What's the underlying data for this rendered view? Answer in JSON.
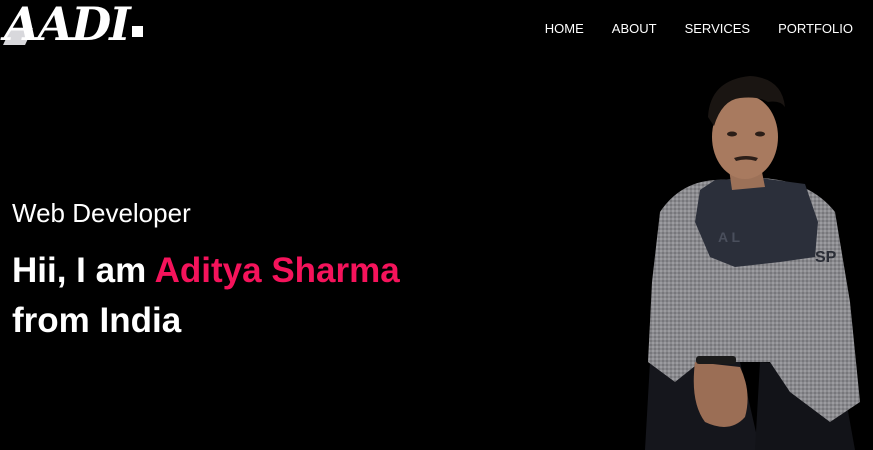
{
  "logo": {
    "text": "AADI"
  },
  "nav": {
    "items": [
      {
        "label": "HOME"
      },
      {
        "label": "ABOUT"
      },
      {
        "label": "SERVICES"
      },
      {
        "label": "PORTFOLIO"
      }
    ]
  },
  "hero": {
    "role": "Web Developer",
    "greeting": "Hii, I am ",
    "name": "Aditya Sharma",
    "location": "from India"
  },
  "colors": {
    "background": "#000000",
    "accent": "#f5135b",
    "text": "#ffffff"
  },
  "icons": [
    "profile-photo"
  ]
}
